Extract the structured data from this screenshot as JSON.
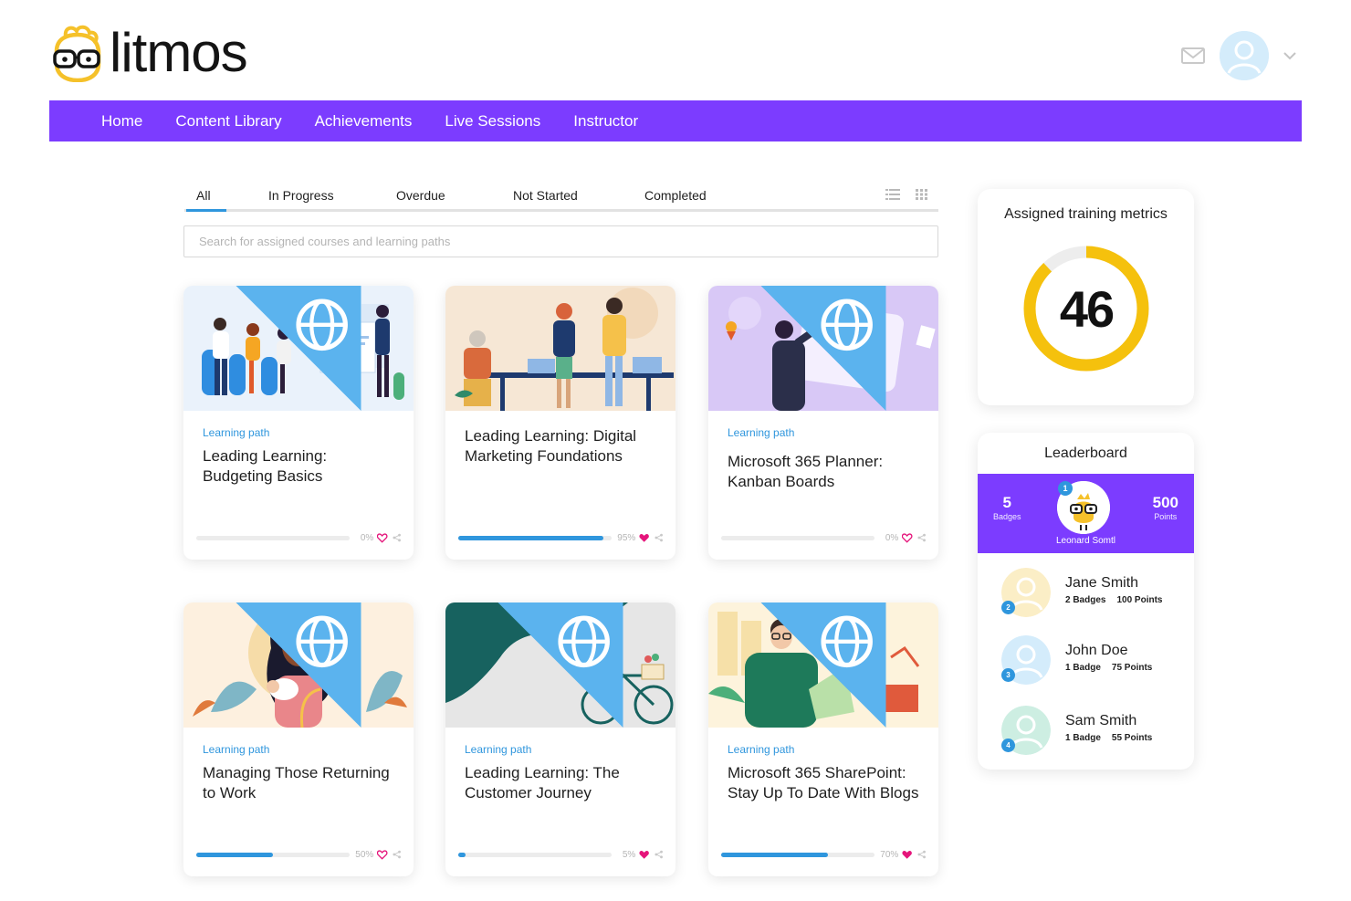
{
  "brand": {
    "name": "litmos",
    "accent": "#7c3cff",
    "link_blue": "#2f96dd",
    "logo_yellow": "#f5c12a"
  },
  "header": {
    "icons": [
      "mail-icon",
      "user-avatar",
      "chevron-down-icon"
    ]
  },
  "nav": [
    "Home",
    "Content Library",
    "Achievements",
    "Live Sessions",
    "Instructor"
  ],
  "filters": {
    "tabs": [
      "All",
      "In Progress",
      "Overdue",
      "Not Started",
      "Completed"
    ],
    "active": "All",
    "view_icons": [
      "list-view-icon",
      "grid-view-icon"
    ]
  },
  "search": {
    "placeholder": "Search for assigned courses and learning paths",
    "value": ""
  },
  "cards": [
    {
      "kind": "Learning path",
      "title": "Leading Learning: Budgeting Basics",
      "progress": "0%",
      "fill": 0,
      "liked": false
    },
    {
      "kind": "",
      "title": "Leading Learning: Digital Marketing Foundations",
      "progress": "95%",
      "fill": 0.95,
      "liked": true
    },
    {
      "kind": "Learning path",
      "title": "Microsoft 365 Planner: Kanban Boards",
      "progress": "0%",
      "fill": 0,
      "liked": false
    },
    {
      "kind": "Learning path",
      "title": "Managing Those Returning to Work",
      "progress": "50%",
      "fill": 0.5,
      "liked": false
    },
    {
      "kind": "Learning path",
      "title": "Leading Learning: The Customer Journey",
      "progress": "5%",
      "fill": 0.05,
      "liked": true
    },
    {
      "kind": "Learning path",
      "title": "Microsoft 365 SharePoint: Stay Up To Date With Blogs",
      "progress": "70%",
      "fill": 0.7,
      "liked": true
    }
  ],
  "metrics": {
    "title": "Assigned training metrics",
    "value": "46",
    "ring_fraction": 0.88
  },
  "leaderboard": {
    "title": "Leaderboard",
    "top": {
      "rank": "1",
      "name": "Leonard Somtl",
      "badges": "5",
      "badges_label": "Badges",
      "points": "500",
      "points_label": "Points"
    },
    "rows": [
      {
        "rank": "2",
        "name": "Jane Smith",
        "badges": "2 Badges",
        "points": "100 Points",
        "color": "#fbeec6"
      },
      {
        "rank": "3",
        "name": "John Doe",
        "badges": "1 Badge",
        "points": "75 Points",
        "color": "#d4ecfb"
      },
      {
        "rank": "4",
        "name": "Sam Smith",
        "badges": "1 Badge",
        "points": "55 Points",
        "color": "#cdeee2"
      }
    ]
  }
}
